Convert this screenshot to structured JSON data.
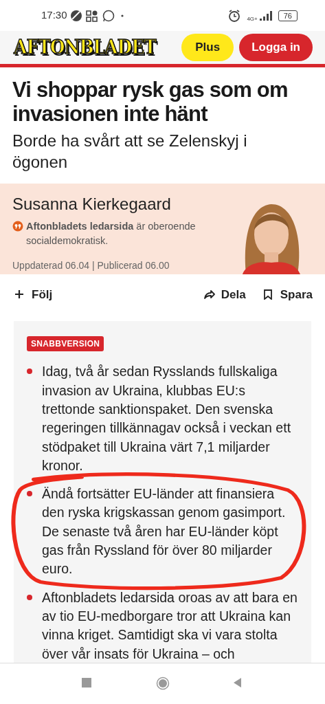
{
  "status_bar": {
    "time": "17:30",
    "network": "4G+",
    "battery": "76"
  },
  "header": {
    "logo": "AFTONBLADET",
    "buttons": [
      {
        "label": "Plus",
        "kind": "plus"
      },
      {
        "label": "Logga in",
        "kind": "login"
      }
    ]
  },
  "article": {
    "title": "Vi shoppar rysk gas som om invasionen inte hänt",
    "subtitle": "Borde ha svårt att se Zelenskyj i ögonen",
    "author": {
      "name": "Susanna Kierkegaard",
      "note": "**Aftonbladets ledarsida** är oberoende socialdemokratisk.",
      "dates": "Uppdaterad 06.04 | Publicerad 06.00"
    },
    "actions": [
      {
        "label": "Följ",
        "kind": "follow"
      },
      {
        "label": "Dela",
        "kind": "share"
      },
      {
        "label": "Spara",
        "kind": "save"
      }
    ],
    "summary": {
      "badge": "SNABBVERSION",
      "bullets": [
        {
          "text": "Idag, två år sedan Rysslands fullskaliga invasion av Ukraina, klubbas EU:s trettonde sanktionspaket. Den svenska regeringen tillkännagav också i veckan ett stödpaket till Ukraina värt 7,1 miljarder kronor.",
          "circled": false
        },
        {
          "text": "Ändå fortsätter EU-länder att finansiera den ryska krigskassan genom gasimport. De senaste två åren har EU-länder köpt gas från Ryssland för över 80 miljarder euro.",
          "circled": true
        },
        {
          "text": "Aftonbladets ledarsida oroas av att bara en av tio EU-medborgare tror att Ukraina kan vinna kriget. Samtidigt ska vi vara stolta över vår insats för Ukraina – och",
          "circled": false
        }
      ]
    }
  },
  "nav_bar": {
    "buttons": [
      {
        "kind": "recents"
      },
      {
        "kind": "home"
      },
      {
        "kind": "back"
      }
    ]
  }
}
